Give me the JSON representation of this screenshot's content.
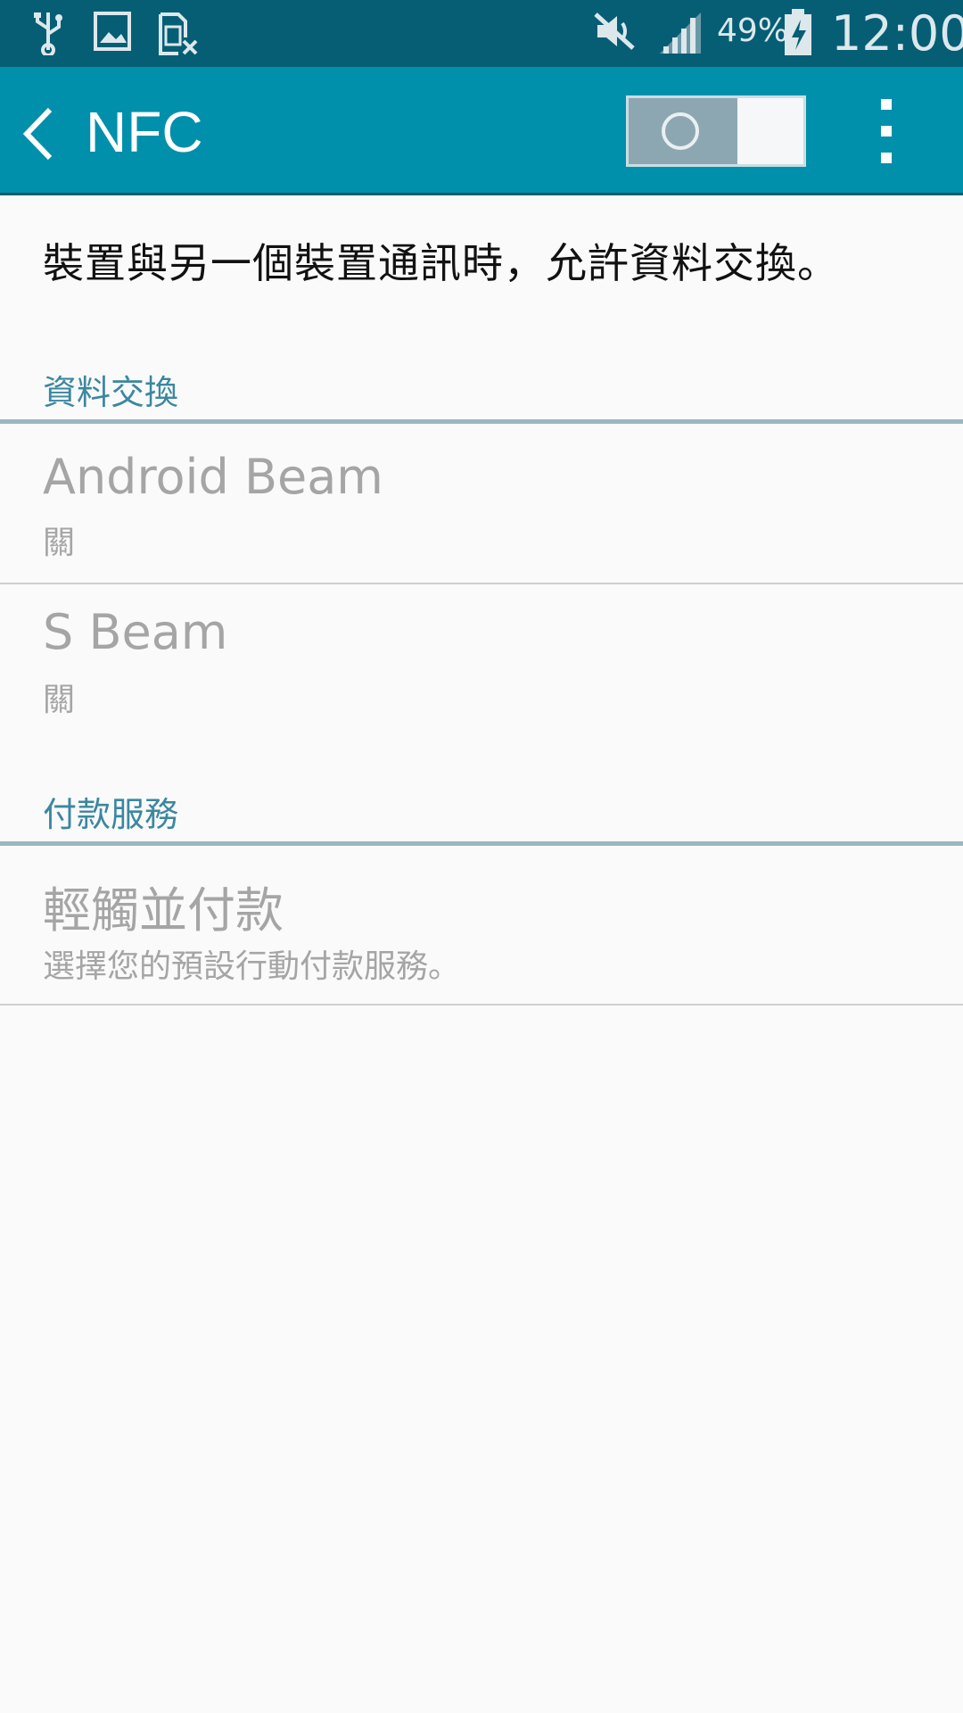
{
  "status_bar": {
    "battery_percent": "49%",
    "time": "12:00",
    "icons": [
      "usb-icon",
      "image-icon",
      "no-sim-icon",
      "mute-icon",
      "signal-icon",
      "battery-charging-icon"
    ]
  },
  "app_bar": {
    "title": "NFC",
    "toggle_state": "off"
  },
  "description": "裝置與另一個裝置通訊時，允許資料交換。",
  "sections": [
    {
      "header": "資料交換",
      "items": [
        {
          "title": "Android Beam",
          "subtitle": "關"
        },
        {
          "title": "S Beam",
          "subtitle": "關"
        }
      ]
    },
    {
      "header": "付款服務",
      "items": [
        {
          "title": "輕觸並付款",
          "subtitle": "選擇您的預設行動付款服務。"
        }
      ]
    }
  ],
  "colors": {
    "status_bar": "#065e75",
    "app_bar": "#0190ab",
    "section_header": "#3b87a0",
    "disabled_text": "#a5a5a5"
  }
}
